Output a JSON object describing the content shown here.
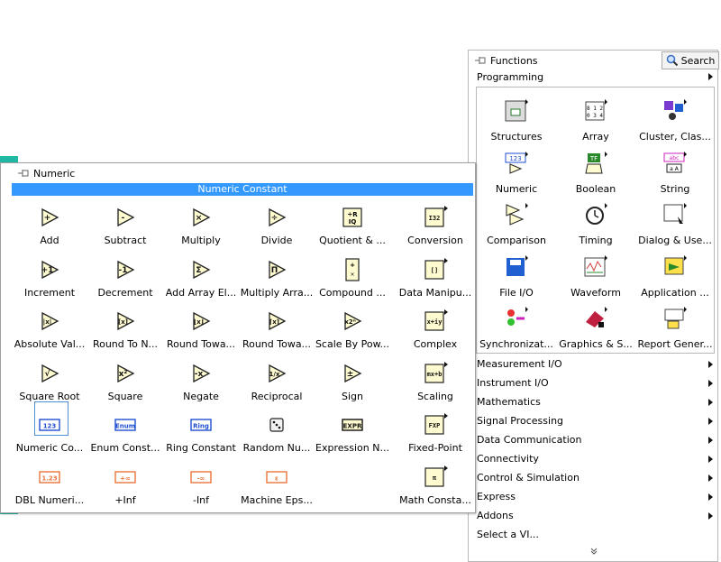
{
  "functions_palette": {
    "title": "Functions",
    "search_label": "Search",
    "category": "Programming",
    "grid_items": [
      {
        "label": "Structures",
        "icon": "structures-icon"
      },
      {
        "label": "Array",
        "icon": "array-icon"
      },
      {
        "label": "Cluster, Clas...",
        "icon": "cluster-icon"
      },
      {
        "label": "Numeric",
        "icon": "numeric-icon"
      },
      {
        "label": "Boolean",
        "icon": "boolean-icon"
      },
      {
        "label": "String",
        "icon": "string-icon"
      },
      {
        "label": "Comparison",
        "icon": "comparison-icon"
      },
      {
        "label": "Timing",
        "icon": "timing-icon"
      },
      {
        "label": "Dialog & Use...",
        "icon": "dialog-icon"
      },
      {
        "label": "File I/O",
        "icon": "file-io-icon"
      },
      {
        "label": "Waveform",
        "icon": "waveform-icon"
      },
      {
        "label": "Application ...",
        "icon": "application-icon"
      },
      {
        "label": "Synchronizat...",
        "icon": "synchronization-icon"
      },
      {
        "label": "Graphics & S...",
        "icon": "graphics-icon"
      },
      {
        "label": "Report Gener...",
        "icon": "report-icon"
      }
    ],
    "list_items": [
      {
        "label": "Measurement I/O"
      },
      {
        "label": "Instrument I/O"
      },
      {
        "label": "Mathematics"
      },
      {
        "label": "Signal Processing"
      },
      {
        "label": "Data Communication"
      },
      {
        "label": "Connectivity"
      },
      {
        "label": "Control & Simulation"
      },
      {
        "label": "Express"
      },
      {
        "label": "Addons"
      }
    ],
    "select_vi": "Select a VI..."
  },
  "numeric_palette": {
    "title": "Numeric",
    "highlight": "Numeric Constant",
    "items": [
      {
        "label": "Add",
        "glyph": "+"
      },
      {
        "label": "Subtract",
        "glyph": "-"
      },
      {
        "label": "Multiply",
        "glyph": "×"
      },
      {
        "label": "Divide",
        "glyph": "÷"
      },
      {
        "label": "Quotient & ...",
        "glyph": "R"
      },
      {
        "label": "Conversion",
        "glyph": "I32"
      },
      {
        "label": "Increment",
        "glyph": "+1"
      },
      {
        "label": "Decrement",
        "glyph": "-1"
      },
      {
        "label": "Add Array El...",
        "glyph": "Σ"
      },
      {
        "label": "Multiply Arra...",
        "glyph": "Π"
      },
      {
        "label": "Compound ...",
        "glyph": "+"
      },
      {
        "label": "Data Manipu...",
        "glyph": "[]"
      },
      {
        "label": "Absolute Val...",
        "glyph": "|x|"
      },
      {
        "label": "Round To N...",
        "glyph": "[x]"
      },
      {
        "label": "Round Towa...",
        "glyph": "⌊x⌋"
      },
      {
        "label": "Round Towa...",
        "glyph": "⌈x⌉"
      },
      {
        "label": "Scale By Pow...",
        "glyph": "x2ⁿ"
      },
      {
        "label": "Complex",
        "glyph": "x+iy"
      },
      {
        "label": "Square Root",
        "glyph": "√"
      },
      {
        "label": "Square",
        "glyph": "x²"
      },
      {
        "label": "Negate",
        "glyph": "-x"
      },
      {
        "label": "Reciprocal",
        "glyph": "1/x"
      },
      {
        "label": "Sign",
        "glyph": "±"
      },
      {
        "label": "Scaling",
        "glyph": "mx+b"
      },
      {
        "label": "Numeric Co...",
        "glyph": "123"
      },
      {
        "label": "Enum Const...",
        "glyph": "Enum"
      },
      {
        "label": "Ring Constant",
        "glyph": "Ring"
      },
      {
        "label": "Random Nu...",
        "glyph": "dice"
      },
      {
        "label": "Expression N...",
        "glyph": "EXPR"
      },
      {
        "label": "Fixed-Point",
        "glyph": "FXP"
      },
      {
        "label": "DBL Numeri...",
        "glyph": "1.23"
      },
      {
        "label": "+Inf",
        "glyph": "+∞"
      },
      {
        "label": "-Inf",
        "glyph": "-∞"
      },
      {
        "label": "Machine Eps...",
        "glyph": "ε"
      },
      {
        "label": "",
        "glyph": ""
      },
      {
        "label": "Math Consta...",
        "glyph": "π"
      }
    ]
  },
  "colors": {
    "highlight": "#3399ff",
    "background_strip": "#1fb8a4",
    "numeric_icon_fill": "#fffbd0",
    "constant_blue": "#1f4fd0",
    "constant_orange": "#e8743b"
  }
}
